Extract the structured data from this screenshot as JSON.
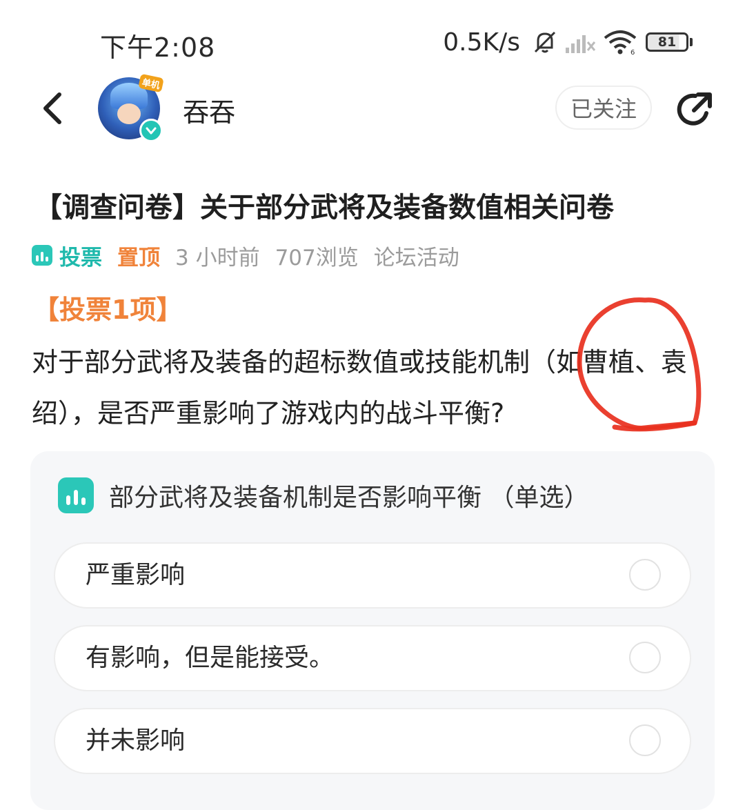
{
  "status_bar": {
    "time": "下午2:08",
    "net_speed": "0.5K/s",
    "battery": "81",
    "battery_level": 0.81
  },
  "header": {
    "username": "吞吞",
    "avatar_tag": "单机",
    "follow_label": "已关注"
  },
  "post": {
    "title": "【调查问卷】关于部分武将及装备数值相关问卷",
    "meta": {
      "vote_tag": "投票",
      "pin_tag": "置顶",
      "time_ago": "3 小时前",
      "views": "707浏览",
      "category": "论坛活动"
    },
    "vote_count_heading": "【投票1项】",
    "body": "对于部分武将及装备的超标数值或技能机制（如曹植、袁绍），是否严重影响了游戏内的战斗平衡?"
  },
  "poll": {
    "question": "部分武将及装备机制是否影响平衡 （单选）",
    "options": [
      {
        "label": "严重影响"
      },
      {
        "label": "有影响，但是能接受。"
      },
      {
        "label": "并未影响"
      }
    ]
  },
  "colors": {
    "accent_teal": "#2bc7b8",
    "accent_orange": "#f0833a",
    "annotation_red": "#e8301e",
    "meta_gray": "#9b9b9b",
    "card_bg": "#f6f7f9"
  }
}
